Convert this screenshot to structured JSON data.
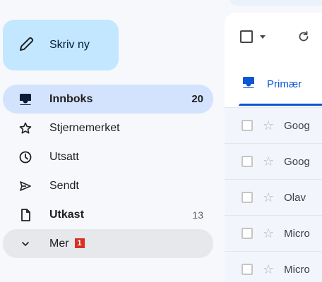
{
  "sidebar": {
    "compose_label": "Skriv ny",
    "items": [
      {
        "label": "Innboks",
        "count": "20"
      },
      {
        "label": "Stjernemerket",
        "count": ""
      },
      {
        "label": "Utsatt",
        "count": ""
      },
      {
        "label": "Sendt",
        "count": ""
      },
      {
        "label": "Utkast",
        "count": "13"
      },
      {
        "label": "Mer",
        "badge": "1"
      }
    ]
  },
  "main": {
    "tab_primary": "Primær",
    "rows": [
      {
        "sender": "Goog"
      },
      {
        "sender": "Goog"
      },
      {
        "sender": "Olav"
      },
      {
        "sender": "Micro"
      },
      {
        "sender": "Micro"
      }
    ]
  },
  "colors": {
    "compose_bg": "#c2e7ff",
    "active_bg": "#d3e3fd",
    "accent": "#0b57d0",
    "badge": "#d93025"
  }
}
